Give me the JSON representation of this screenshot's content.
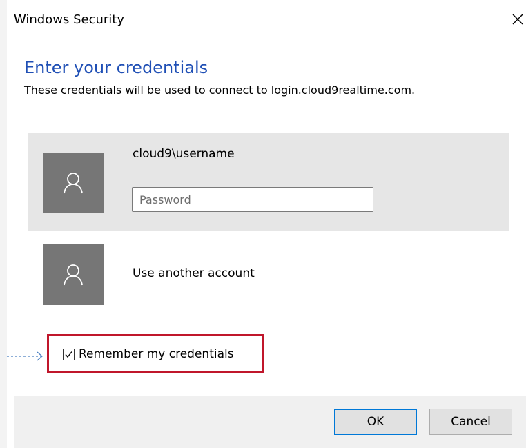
{
  "window": {
    "title": "Windows Security",
    "close_icon": "close-icon"
  },
  "dialog": {
    "heading": "Enter your credentials",
    "subtext": "These credentials will be used to connect to login.cloud9realtime.com."
  },
  "accounts": {
    "selected": {
      "name": "cloud9\\username",
      "avatar_icon": "user-icon",
      "password_placeholder": "Password",
      "password_value": ""
    },
    "other": {
      "label": "Use another account",
      "avatar_icon": "user-icon"
    }
  },
  "remember": {
    "label": "Remember my credentials",
    "checked": true
  },
  "buttons": {
    "ok_label": "OK",
    "cancel_label": "Cancel"
  },
  "colors": {
    "heading": "#1f4fb5",
    "avatar_bg": "#767676",
    "selected_account_bg": "#e6e6e6",
    "highlight_border": "#c0162b",
    "ok_border": "#0078d7",
    "footer_bg": "#f0f0f0"
  }
}
